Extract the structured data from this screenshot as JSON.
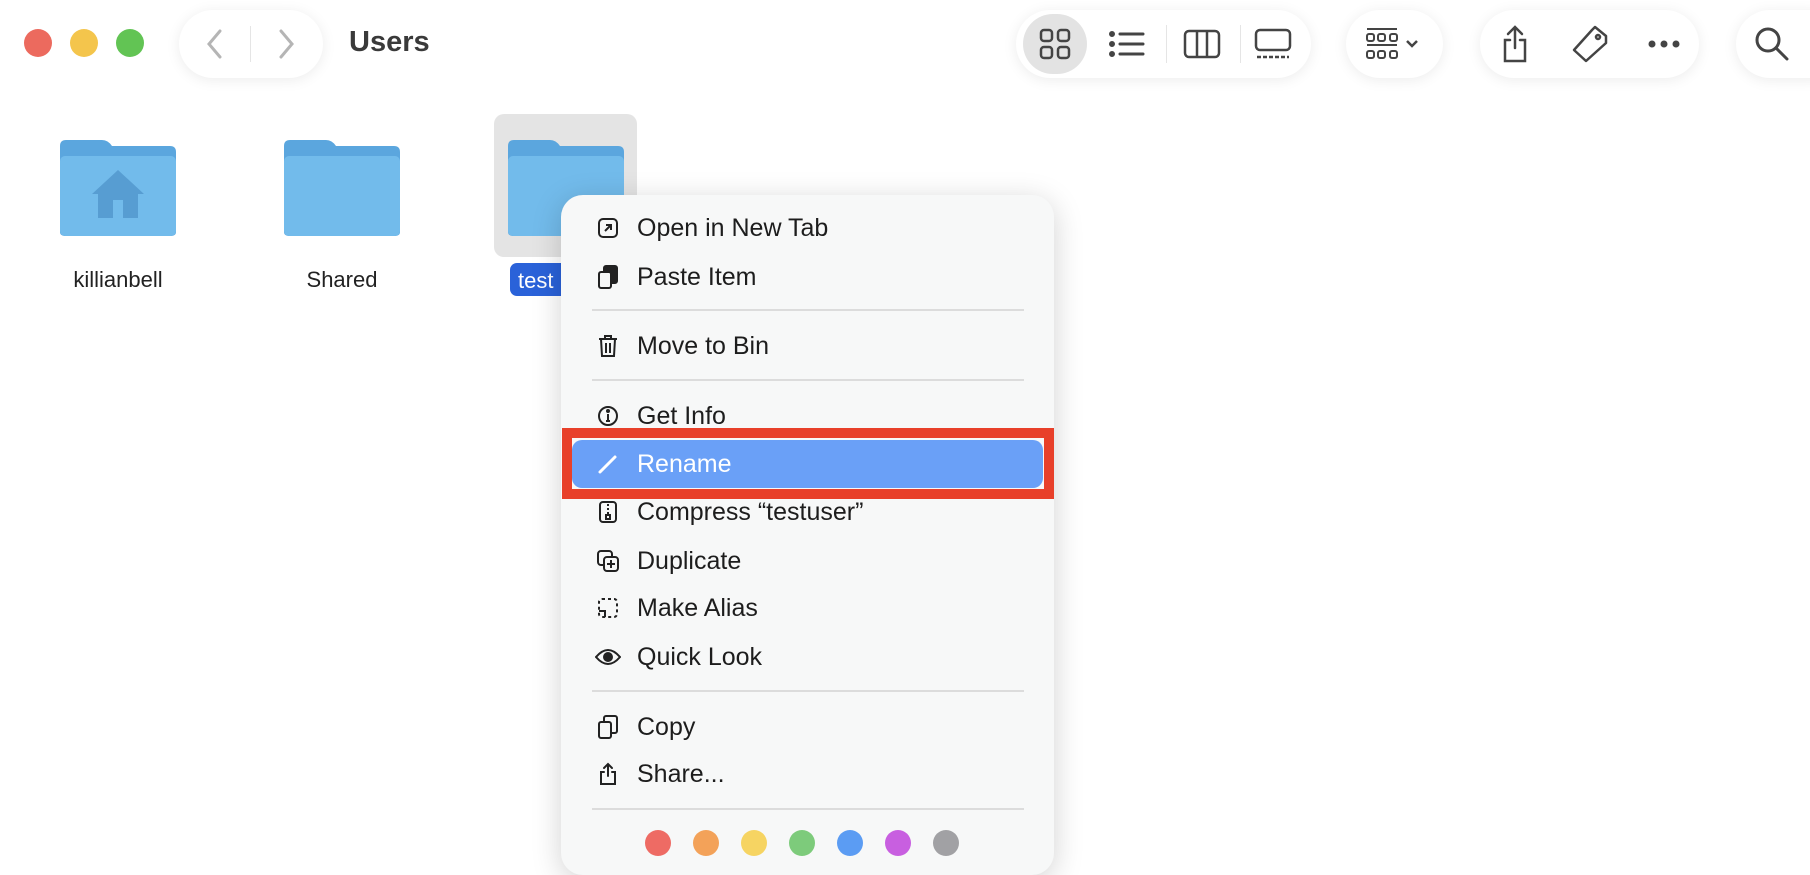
{
  "window": {
    "title": "Users"
  },
  "colors": {
    "close": "#ec6a5e",
    "minimize": "#f4c54c",
    "zoom": "#62c454",
    "selection": "#2a62d9",
    "highlight": "#6aa0f7",
    "annotation": "#e8402a",
    "folder": "#6fb6e8"
  },
  "toolbar": {
    "icons": [
      "back-icon",
      "forward-icon",
      "icon-view-icon",
      "list-view-icon",
      "column-view-icon",
      "gallery-view-icon",
      "group-icon",
      "share-icon",
      "tag-icon",
      "more-icon",
      "search-icon"
    ]
  },
  "files": [
    {
      "name": "killianbell",
      "type": "home-folder"
    },
    {
      "name": "Shared",
      "type": "folder"
    },
    {
      "name": "testuser",
      "type": "folder",
      "selected": true,
      "visible_label": "test"
    }
  ],
  "context_menu": {
    "items": [
      {
        "label": "Open in New Tab",
        "icon": "open-new-tab-icon"
      },
      {
        "label": "Paste Item",
        "icon": "paste-icon"
      },
      {
        "label": "Move to Bin",
        "icon": "trash-icon"
      },
      {
        "label": "Get Info",
        "icon": "info-icon"
      },
      {
        "label": "Rename",
        "icon": "pencil-icon",
        "highlighted": true
      },
      {
        "label": "Compress “testuser”",
        "icon": "zip-icon"
      },
      {
        "label": "Duplicate",
        "icon": "duplicate-icon"
      },
      {
        "label": "Make Alias",
        "icon": "alias-icon"
      },
      {
        "label": "Quick Look",
        "icon": "eye-icon"
      },
      {
        "label": "Copy",
        "icon": "copy-icon"
      },
      {
        "label": "Share...",
        "icon": "share-icon"
      }
    ],
    "tag_colors": [
      "#ee6b64",
      "#f3a259",
      "#f6d462",
      "#7dcb7b",
      "#5b9cf3",
      "#c85fe0",
      "#a1a1a4"
    ]
  }
}
